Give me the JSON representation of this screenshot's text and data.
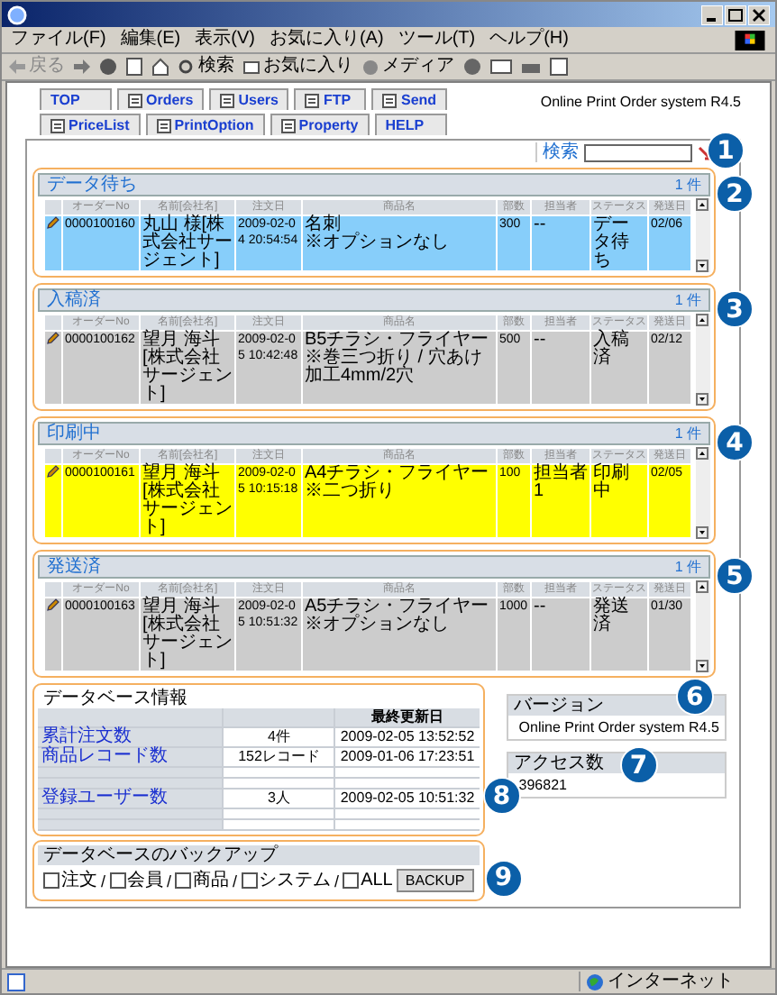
{
  "browser": {
    "menu": [
      "ファイル(F)",
      "編集(E)",
      "表示(V)",
      "お気に入り(A)",
      "ツール(T)",
      "ヘルプ(H)"
    ],
    "toolbar": [
      "戻る",
      "検索",
      "お気に入り",
      "メディア"
    ],
    "status": "インターネット"
  },
  "tabs_row1": [
    {
      "label": "TOP",
      "icon": false
    },
    {
      "label": "Orders",
      "icon": true
    },
    {
      "label": "Users",
      "icon": true
    },
    {
      "label": "FTP",
      "icon": true
    },
    {
      "label": "Send",
      "icon": true
    }
  ],
  "app_title": "Online Print Order system R4.5",
  "tabs_row2": [
    {
      "label": "PriceList",
      "icon": true
    },
    {
      "label": "PrintOption",
      "icon": true
    },
    {
      "label": "Property",
      "icon": true
    },
    {
      "label": "HELP",
      "icon": false
    }
  ],
  "search": {
    "label": "検索",
    "callout": "1"
  },
  "sections": [
    {
      "title": "データ待ち",
      "count": "1 件",
      "callout": "2",
      "columns": [
        "オーダーNo",
        "名前[会社名]",
        "注文日",
        "商品名",
        "部数",
        "担当者",
        "ステータス",
        "発送日"
      ],
      "row": {
        "color": "#87cefa",
        "order_no": "0000100160",
        "name": "丸山 様[株式会社サージェント]",
        "date": "2009-02-04 20:54:54",
        "product": "名刺",
        "option": "※オプションなし",
        "qty": "300",
        "staff": "--",
        "status": "データ待ち",
        "ship": "02/06"
      }
    },
    {
      "title": "入稿済",
      "count": "1 件",
      "callout": "3",
      "columns": [
        "オーダーNo",
        "名前[会社名]",
        "注文日",
        "商品名",
        "部数",
        "担当者",
        "ステータス",
        "発送日"
      ],
      "row": {
        "color": "#cccccc",
        "order_no": "0000100162",
        "name": "望月 海斗[株式会社サージェント]",
        "date": "2009-02-05 10:42:48",
        "product": "B5チラシ・フライヤー",
        "option": "※巻三つ折り / 穴あけ加工4mm/2穴",
        "qty": "500",
        "staff": "--",
        "status": "入稿済",
        "ship": "02/12"
      }
    },
    {
      "title": "印刷中",
      "count": "1 件",
      "callout": "4",
      "columns": [
        "オーダーNo",
        "名前[会社名]",
        "注文日",
        "商品名",
        "部数",
        "担当者",
        "ステータス",
        "発送日"
      ],
      "row": {
        "color": "#ffff00",
        "order_no": "0000100161",
        "name": "望月 海斗[株式会社サージェント]",
        "date": "2009-02-05 10:15:18",
        "product": "A4チラシ・フライヤー",
        "option": "※二つ折り",
        "qty": "100",
        "staff": "担当者1",
        "status": "印刷中",
        "ship": "02/05"
      }
    },
    {
      "title": "発送済",
      "count": "1 件",
      "callout": "5",
      "columns": [
        "オーダーNo",
        "名前[会社名]",
        "注文日",
        "商品名",
        "部数",
        "担当者",
        "ステータス",
        "発送日"
      ],
      "row": {
        "color": "#cccccc",
        "order_no": "0000100163",
        "name": "望月 海斗[株式会社サージェント]",
        "date": "2009-02-05 10:51:32",
        "product": "A5チラシ・フライヤー",
        "option": "※オプションなし",
        "qty": "1000",
        "staff": "--",
        "status": "発送済",
        "ship": "01/30"
      }
    }
  ],
  "db_info": {
    "title": "データベース情報",
    "callout": "8",
    "header": "最終更新日",
    "rows": [
      {
        "label": "累計注文数",
        "value": "4件",
        "updated": "2009-02-05 13:52:52"
      },
      {
        "label": "商品レコード数",
        "value": "152レコード",
        "updated": "2009-01-06 17:23:51"
      },
      {},
      {},
      {
        "label": "登録ユーザー数",
        "value": "3人",
        "updated": "2009-02-05 10:51:32"
      },
      {},
      {}
    ]
  },
  "version": {
    "title": "バージョン",
    "value": "Online Print Order system R4.5",
    "callout": "6"
  },
  "access": {
    "title": "アクセス数",
    "value": "396821",
    "callout": "7"
  },
  "backup": {
    "title": "データベースのバックアップ",
    "callout": "9",
    "separator": "/",
    "options": [
      {
        "label": "注文",
        "checked": false
      },
      {
        "label": "会員",
        "checked": false
      },
      {
        "label": "商品",
        "checked": false
      },
      {
        "label": "システム",
        "checked": false
      },
      {
        "label": "ALL",
        "checked": false
      }
    ],
    "button": "BACKUP"
  }
}
